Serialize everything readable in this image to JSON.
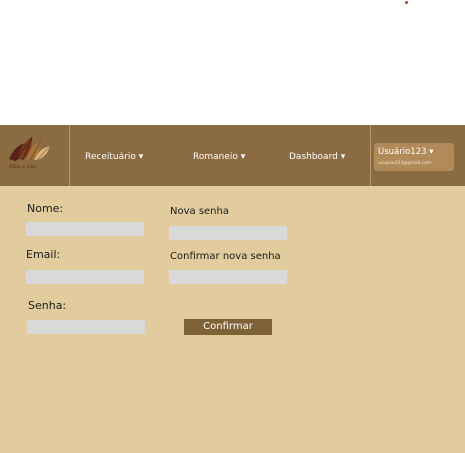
{
  "colors": {
    "nav_bg": "#8a6b42",
    "content_bg": "#e2cc9d",
    "button_bg": "#7f6138",
    "user_box_bg": "#b08a58",
    "dot": "#d0312d"
  },
  "logo": {
    "tagline": "Pães e Cia"
  },
  "nav": {
    "receituario": "Receituário ▾",
    "romaneio": "Romaneio ▾",
    "dashboard": "Dashboard ▾"
  },
  "user": {
    "name": "Usuário123  ▾",
    "email": "usuario123@gmail.com"
  },
  "form": {
    "nome_label": "Nome:",
    "email_label": "Email:",
    "senha_label": "Senha:",
    "nova_senha_label": "Nova senha",
    "confirmar_label": "Confirmar nova senha",
    "confirm_button": "Confirmar"
  }
}
